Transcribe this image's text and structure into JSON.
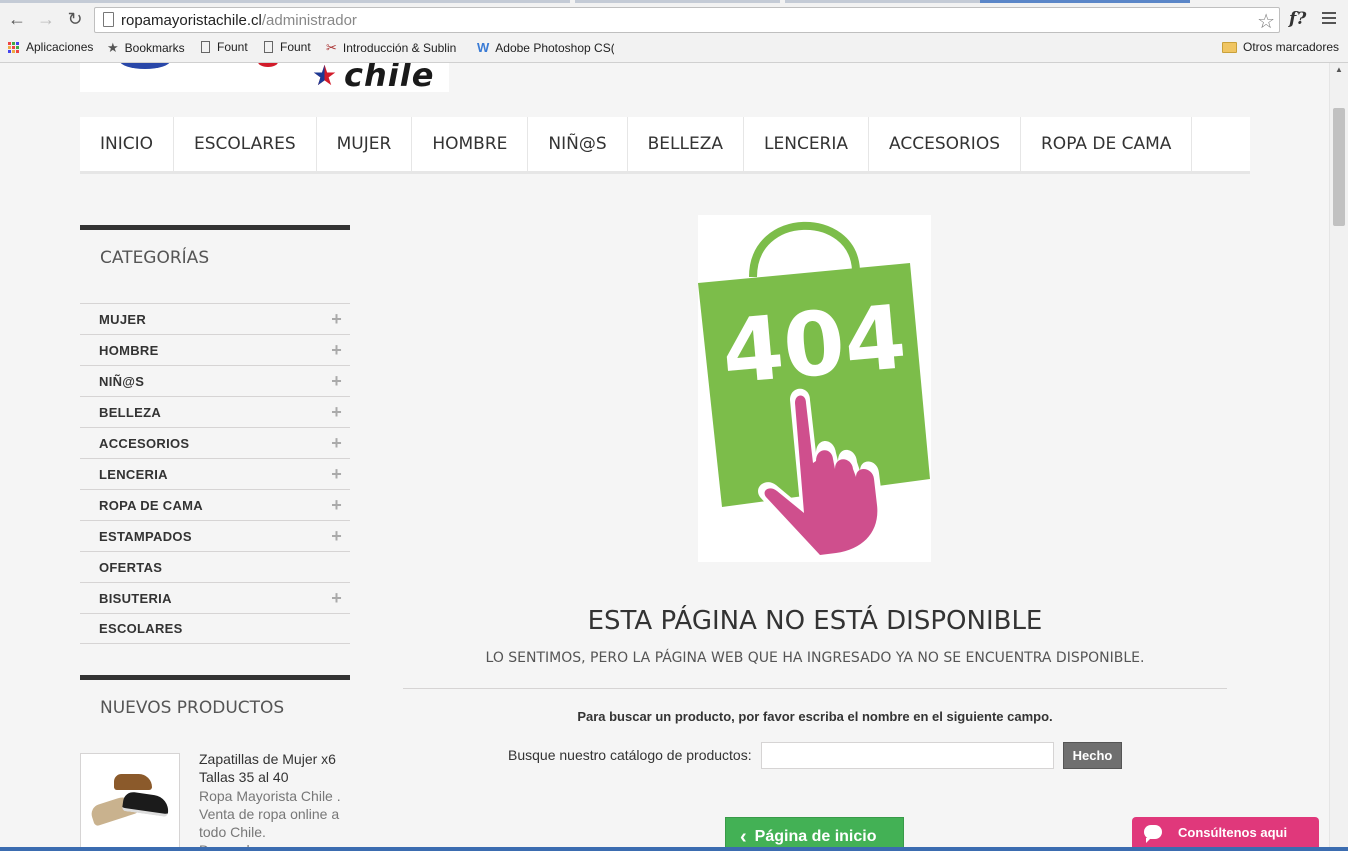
{
  "browser": {
    "url_domain": "ropamayoristachile.cl",
    "url_path": "/administrador",
    "back_icon": "←",
    "forward_icon": "→",
    "reload_icon": "↻",
    "star_icon": "☆",
    "extension_label": "f?",
    "bookmarks": [
      {
        "label": "Aplicaciones"
      },
      {
        "label": "Bookmarks"
      },
      {
        "label": "Fount"
      },
      {
        "label": "Fount"
      },
      {
        "label": "Introducción & Sublin"
      },
      {
        "label": "Adobe Photoshop CS("
      }
    ],
    "other_bookmarks": "Otros marcadores"
  },
  "site": {
    "logo_text": "chile",
    "menu": [
      "INICIO",
      "ESCOLARES",
      "MUJER",
      "HOMBRE",
      "NIÑ@S",
      "BELLEZA",
      "LENCERIA",
      "ACCESORIOS",
      "ROPA DE CAMA"
    ]
  },
  "sidebar": {
    "categories_title": "CATEGORÍAS",
    "categories": [
      {
        "label": "MUJER",
        "expandable": true
      },
      {
        "label": "HOMBRE",
        "expandable": true
      },
      {
        "label": "NIÑ@S",
        "expandable": true
      },
      {
        "label": "BELLEZA",
        "expandable": true
      },
      {
        "label": "ACCESORIOS",
        "expandable": true
      },
      {
        "label": "LENCERIA",
        "expandable": true
      },
      {
        "label": "ROPA DE CAMA",
        "expandable": true
      },
      {
        "label": "ESTAMPADOS",
        "expandable": true
      },
      {
        "label": "OFERTAS",
        "expandable": false
      },
      {
        "label": "BISUTERIA",
        "expandable": true
      },
      {
        "label": "ESCOLARES",
        "expandable": false
      }
    ],
    "plus_glyph": "+",
    "new_products_title": "NUEVOS PRODUCTOS",
    "new_product": {
      "name": "Zapatillas de Mujer x6 Tallas 35 al 40",
      "description": "Ropa Mayorista Chile . Venta de ropa online a todo Chile. Despachamos a"
    }
  },
  "main": {
    "error_code": "404",
    "title": "ESTA PÁGINA NO ESTÁ DISPONIBLE",
    "subtitle": "LO SENTIMOS, PERO LA PÁGINA WEB QUE HA INGRESADO YA NO SE ENCUENTRA DISPONIBLE.",
    "hint": "Para buscar un producto, por favor escriba el nombre en el siguiente campo.",
    "search_label": "Busque nuestro catálogo de productos:",
    "search_value": "",
    "search_button": "Hecho",
    "home_button": "Página de inicio",
    "home_chevron": "‹"
  },
  "chat": {
    "label": "Consúltenos aqui"
  },
  "colors": {
    "bag_green": "#7cbd4a",
    "hand_pink": "#cf4f8d",
    "home_green": "#43b155",
    "chat_pink": "#e0387b"
  }
}
